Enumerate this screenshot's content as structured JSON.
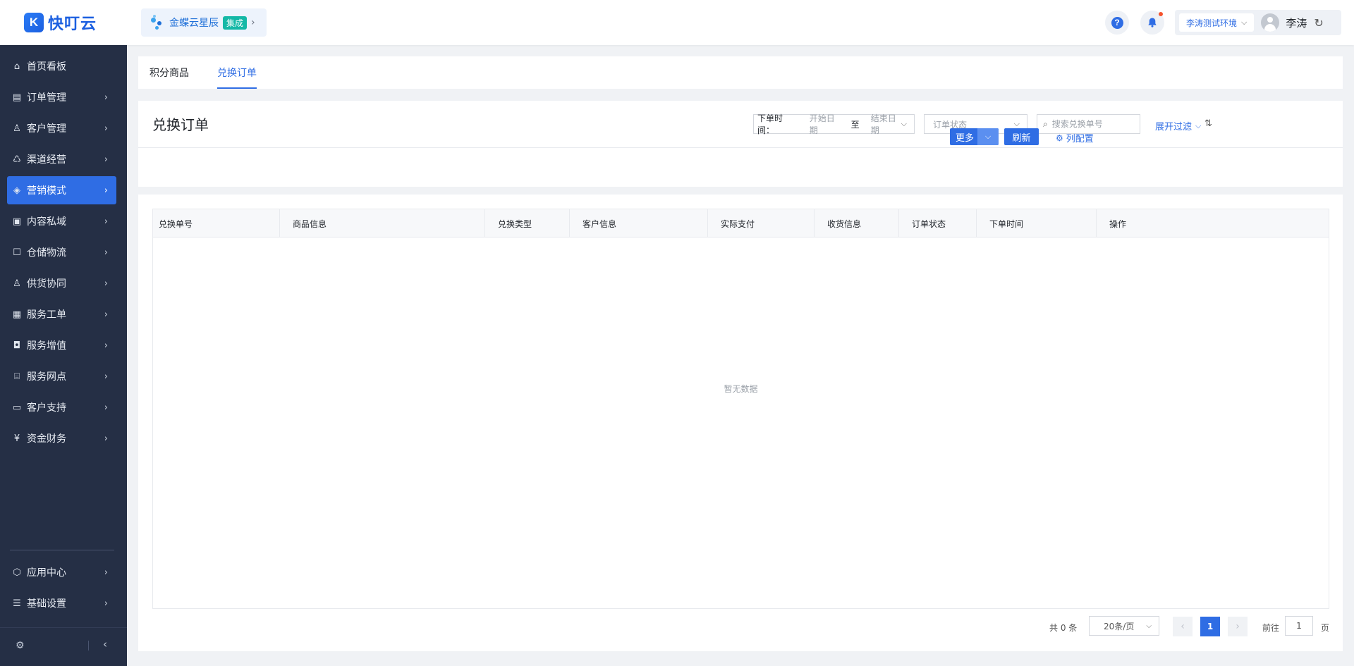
{
  "app": {
    "logo_mark": "K",
    "logo_text": "快叮云"
  },
  "org": {
    "name": "金蝶云星辰",
    "badge": "集成",
    "chevron": "›"
  },
  "header": {
    "help_glyph": "?",
    "bell_glyph": "🔔",
    "env_label": "李涛测试环境",
    "env_chevron": "⌵",
    "user_name": "李涛",
    "refresh_glyph": "↻"
  },
  "sidebar": {
    "items": [
      {
        "label": "首页看板",
        "icon": "⌂",
        "chevron": ""
      },
      {
        "label": "订单管理",
        "icon": "▤",
        "chevron": "›"
      },
      {
        "label": "客户管理",
        "icon": "♙",
        "chevron": "›"
      },
      {
        "label": "渠道经营",
        "icon": "♺",
        "chevron": "›"
      },
      {
        "label": "营销模式",
        "icon": "◈",
        "chevron": "›"
      },
      {
        "label": "内容私域",
        "icon": "▣",
        "chevron": "›"
      },
      {
        "label": "仓储物流",
        "icon": "☐",
        "chevron": "›"
      },
      {
        "label": "供货协同",
        "icon": "♙",
        "chevron": "›"
      },
      {
        "label": "服务工单",
        "icon": "▦",
        "chevron": "›"
      },
      {
        "label": "服务增值",
        "icon": "◘",
        "chevron": "›"
      },
      {
        "label": "服务网点",
        "icon": "⌸",
        "chevron": "›"
      },
      {
        "label": "客户支持",
        "icon": "▭",
        "chevron": "›"
      },
      {
        "label": "资金财务",
        "icon": "¥",
        "chevron": "›"
      }
    ],
    "bottom_items": [
      {
        "label": "应用中心",
        "icon": "⬡",
        "chevron": "›"
      },
      {
        "label": "基础设置",
        "icon": "☰",
        "chevron": "›"
      }
    ],
    "footer_gear": "⚙",
    "footer_collapse": "‹"
  },
  "tabs": [
    {
      "label": "积分商品"
    },
    {
      "label": "兑换订单"
    }
  ],
  "page": {
    "title": "兑换订单"
  },
  "filters": {
    "date_label": "下单时间：",
    "date_start_placeholder": "开始日期",
    "date_to": "至",
    "date_end_placeholder": "结束日期",
    "status_placeholder": "订单状态",
    "search_placeholder": "搜索兑换单号",
    "expand_label": "展开过滤",
    "chevron": "⌵",
    "sort_glyph": "⇅",
    "search_glyph": "⌕"
  },
  "actions": {
    "more_label": "更多",
    "more_chevron": "⌵",
    "refresh_label": "刷新",
    "column_config_label": "列配置",
    "gear_glyph": "⚙"
  },
  "table": {
    "columns": [
      "兑换单号",
      "商品信息",
      "兑换类型",
      "客户信息",
      "实际支付",
      "收货信息",
      "订单状态",
      "下单时间",
      "操作"
    ],
    "empty_text": "暂无数据"
  },
  "pagination": {
    "total_label": "共 0 条",
    "page_size_label": "20条/页",
    "size_chevron": "⌵",
    "prev_glyph": "‹",
    "current_page": "1",
    "next_glyph": "›",
    "goto_label": "前往",
    "goto_value": "1",
    "page_suffix": "页"
  },
  "colors": {
    "accent": "#2f6de4",
    "sidebar_bg": "#252f45",
    "badge": "#14b8a6",
    "notification_dot": "#f5532d"
  }
}
